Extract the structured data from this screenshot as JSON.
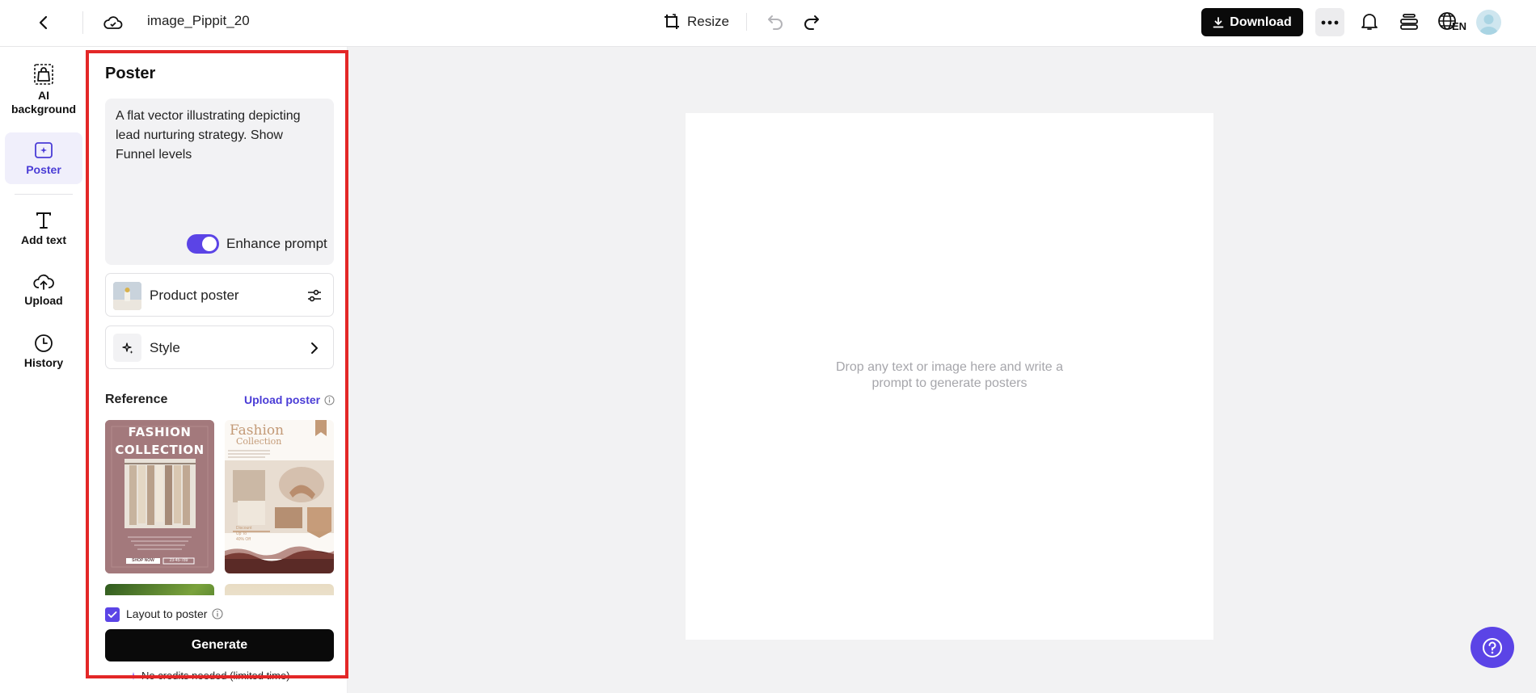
{
  "topbar": {
    "title": "image_Pippit_20",
    "resize_label": "Resize",
    "download_label": "Download",
    "lang": "EN"
  },
  "rail": {
    "items": [
      {
        "label": "AI background",
        "icon": "ai-background-icon"
      },
      {
        "label": "Poster",
        "icon": "poster-icon",
        "active": true
      },
      {
        "label": "Add text",
        "icon": "text-icon"
      },
      {
        "label": "Upload",
        "icon": "upload-icon"
      },
      {
        "label": "History",
        "icon": "history-icon"
      }
    ]
  },
  "panel": {
    "title": "Poster",
    "prompt": "A flat vector illustrating depicting lead nurturing strategy. Show Funnel levels",
    "enhance_label": "Enhance prompt",
    "enhance_on": true,
    "product_poster_label": "Product poster",
    "style_label": "Style",
    "reference_label": "Reference",
    "upload_poster_label": "Upload poster",
    "layout_label": "Layout to poster",
    "layout_checked": true,
    "generate_label": "Generate",
    "credits_note": "No credits needed (limited time)",
    "ref_cards": [
      {
        "heading": "FASHION COLLECTION",
        "cta_left": "SHOP NOW",
        "cta_right": "23-45-789"
      },
      {
        "heading": "Fashion",
        "subheading": "Collection",
        "discount_label": "Discount",
        "discount_line": "Up To",
        "discount_value": "40% Off"
      }
    ]
  },
  "canvas": {
    "hint_line1": "Drop any text or image here and write a",
    "hint_line2": "prompt to generate posters"
  },
  "colors": {
    "accent": "#5b44e6",
    "highlight_frame": "#e32727",
    "button_dark": "#0a0a0a"
  }
}
